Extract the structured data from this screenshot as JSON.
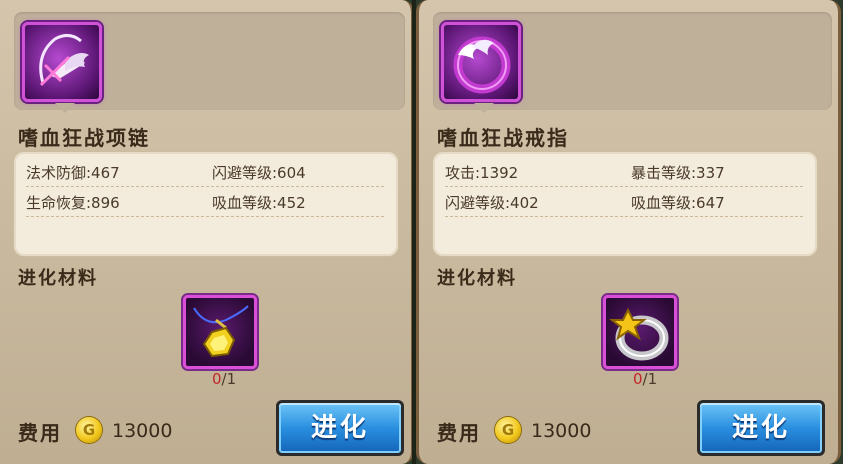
{
  "panels": [
    {
      "item_name": "嗜血狂战项链",
      "icon": "necklace-wing-icon",
      "stats": [
        [
          "法术防御:467",
          "闪避等级:604"
        ],
        [
          "生命恢复:896",
          "吸血等级:452"
        ]
      ],
      "section_title": "进化材料",
      "material_icon": "gem-pendant-icon",
      "material_have": "0",
      "material_need": "/1",
      "cost_label": "费用",
      "coin_symbol": "G",
      "cost_value": "13000",
      "evolve_label": "进化"
    },
    {
      "item_name": "嗜血狂战戒指",
      "icon": "ring-wing-icon",
      "stats": [
        [
          "攻击:1392",
          "暴击等级:337"
        ],
        [
          "闪避等级:402",
          "吸血等级:647"
        ]
      ],
      "section_title": "进化材料",
      "material_icon": "gold-star-ring-icon",
      "material_have": "0",
      "material_need": "/1",
      "cost_label": "费用",
      "coin_symbol": "G",
      "cost_value": "13000",
      "evolve_label": "进化"
    }
  ],
  "colors": {
    "rarity_purple": "#d052d6",
    "button_blue": "#2a8fe0",
    "count_red": "#c0262a"
  }
}
